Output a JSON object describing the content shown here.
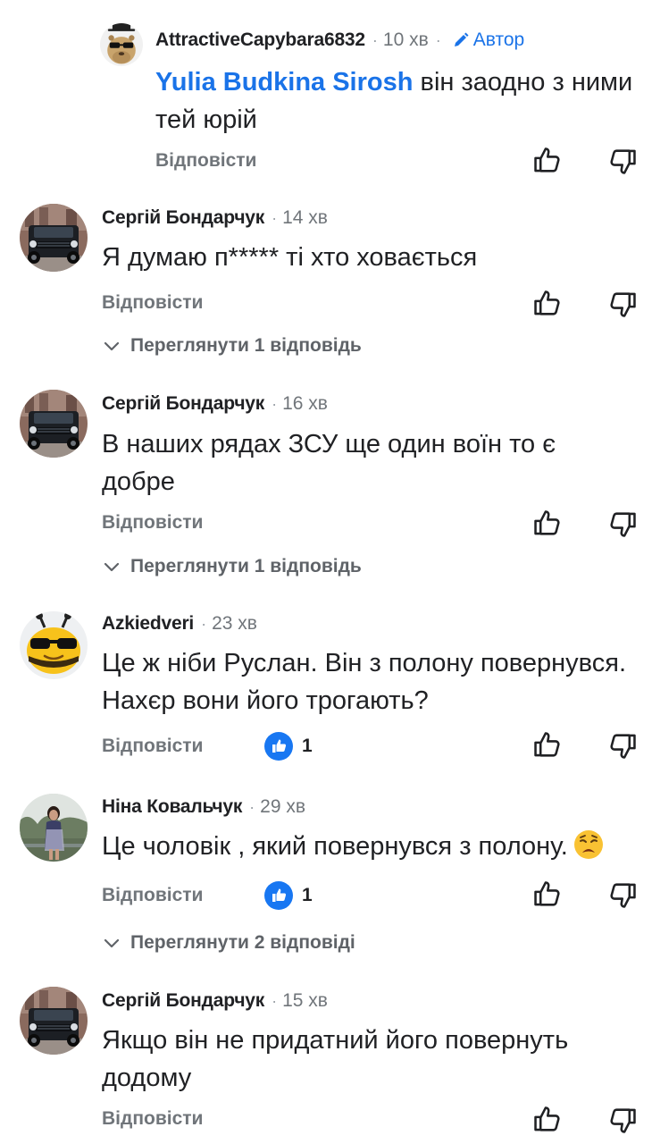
{
  "comments": [
    {
      "author": "AttractiveCapybara6832",
      "time": "10 хв",
      "badge": "Автор",
      "mention": "Yulia Budkina Sirosh",
      "text": "він заодно з ними тей юрій",
      "reply_label": "Відповісти",
      "avatar": "capybara-avatar"
    },
    {
      "author": "Сергій Бондарчук",
      "time": "14 хв",
      "text": "Я думаю п***** ті хто ховається",
      "reply_label": "Відповісти",
      "view_replies": "Переглянути 1 відповідь",
      "avatar": "car-avatar"
    },
    {
      "author": "Сергій Бондарчук",
      "time": "16 хв",
      "text": "В наших рядах ЗСУ ще один воїн то є добре",
      "reply_label": "Відповісти",
      "view_replies": "Переглянути 1 відповідь",
      "avatar": "car-avatar"
    },
    {
      "author": "Azkiedveri",
      "time": "23 хв",
      "text": "Це ж ніби Руслан. Він з полону повернувся. Нахєр вони його трогають?",
      "reply_label": "Відповісти",
      "likes": "1",
      "avatar": "bee-avatar"
    },
    {
      "author": "Ніна Ковальчук",
      "time": "29 хв",
      "text": "Це чоловік , який повернувся з полону.",
      "reply_label": "Відповісти",
      "likes": "1",
      "view_replies": "Переглянути 2 відповіді",
      "avatar": "woman-photo-avatar",
      "emoji": "weary-face-emoji"
    },
    {
      "author": "Сергій Бондарчук",
      "time": "15 хв",
      "text": "Якщо він не придатний його повернуть додому",
      "reply_label": "Відповісти",
      "avatar": "car-avatar"
    }
  ],
  "colors": {
    "link_blue": "#1a73e8",
    "text": "#202124",
    "muted": "#70757a",
    "like_blue": "#1877f2"
  },
  "icons": [
    "thumbs-up-icon",
    "thumbs-down-icon",
    "chevron-down-icon",
    "pencil-icon",
    "like-reaction-icon"
  ]
}
